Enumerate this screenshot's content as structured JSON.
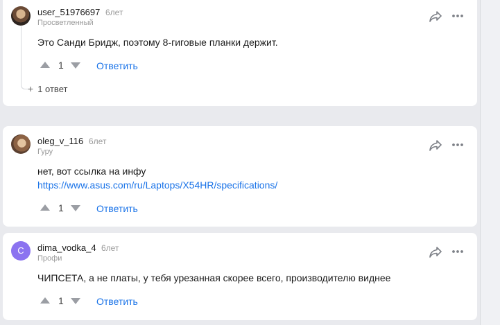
{
  "comments": [
    {
      "username": "user_51976697",
      "age": "6лет",
      "rank": "Просветленный",
      "text": "Это Санди Бридж, поэтому 8-гиговые планки держит.",
      "score": "1",
      "reply_label": "Ответить",
      "replies_label": "1 ответ"
    },
    {
      "username": "oleg_v_116",
      "age": "6лет",
      "rank": "Гуру",
      "text": "нет, вот ссылка на инфу",
      "link": "https://www.asus.com/ru/Laptops/X54HR/specifications/",
      "score": "1",
      "reply_label": "Ответить"
    },
    {
      "username": "dima_vodka_4",
      "age": "6лет",
      "rank": "Профи",
      "avatar_letter": "C",
      "text": "ЧИПСЕТА, а не платы, у тебя урезанная скорее всего, производителю виднее",
      "score": "1",
      "reply_label": "Ответить"
    }
  ],
  "colors": {
    "accent": "#1a73e8",
    "avatar_letter_bg": "#8b73f0",
    "page_bg": "#e9eaee"
  },
  "icons": [
    "share-icon",
    "more-icon",
    "vote-up-icon",
    "vote-down-icon",
    "plus-icon"
  ]
}
